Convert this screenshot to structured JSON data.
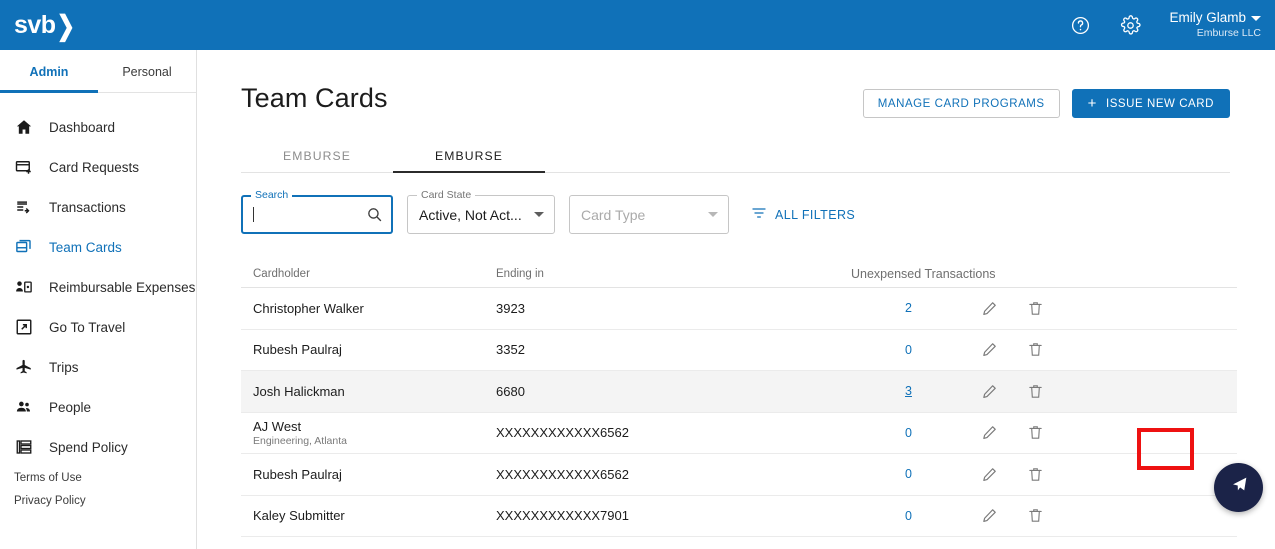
{
  "header": {
    "logo_text": "svb",
    "logo_chevron": "❯",
    "help_icon": "help-circle-icon",
    "settings_icon": "gear-icon",
    "user_name": "Emily Glamb",
    "user_org": "Emburse LLC"
  },
  "sidebar": {
    "tabs": [
      {
        "label": "Admin",
        "active": true
      },
      {
        "label": "Personal",
        "active": false
      }
    ],
    "items": [
      {
        "label": "Dashboard",
        "icon": "home-icon",
        "active": false
      },
      {
        "label": "Card Requests",
        "icon": "card-plus-icon",
        "active": false
      },
      {
        "label": "Transactions",
        "icon": "transactions-icon",
        "active": false
      },
      {
        "label": "Team Cards",
        "icon": "cards-stack-icon",
        "active": true
      },
      {
        "label": "Reimbursable Expenses",
        "icon": "person-card-icon",
        "active": false
      },
      {
        "label": "Go To Travel",
        "icon": "external-link-icon",
        "active": false
      },
      {
        "label": "Trips",
        "icon": "airplane-icon",
        "active": false
      },
      {
        "label": "People",
        "icon": "people-icon",
        "active": false
      },
      {
        "label": "Spend Policy",
        "icon": "policy-list-icon",
        "active": false
      }
    ],
    "footer_links": [
      "Terms of Use",
      "Privacy Policy"
    ]
  },
  "main": {
    "page_title": "Team Cards",
    "manage_programs_label": "MANAGE CARD PROGRAMS",
    "issue_card_label": "ISSUE NEW CARD",
    "issue_card_plus": "+",
    "tabs": [
      {
        "label": "EMBURSE",
        "active": false
      },
      {
        "label": "EMBURSE",
        "active": true
      }
    ],
    "filters": {
      "search_legend": "Search",
      "search_value": "",
      "search_icon": "search-icon",
      "card_state_legend": "Card State",
      "card_state_value": "Active, Not Act...",
      "card_type_placeholder": "Card Type",
      "all_filters_label": "ALL FILTERS",
      "all_filters_icon": "filter-icon"
    },
    "table": {
      "columns": [
        "Cardholder",
        "Ending in",
        "Unexpensed Transactions"
      ],
      "edit_icon": "pencil-icon",
      "delete_icon": "trash-icon",
      "rows": [
        {
          "cardholder": "Christopher Walker",
          "subtitle": "",
          "ending_in": "3923",
          "unexpensed": "2",
          "highlight": false,
          "annotated": false
        },
        {
          "cardholder": "Rubesh Paulraj",
          "subtitle": "",
          "ending_in": "3352",
          "unexpensed": "0",
          "highlight": false,
          "annotated": false
        },
        {
          "cardholder": "Josh Halickman",
          "subtitle": "",
          "ending_in": "6680",
          "unexpensed": "3",
          "highlight": true,
          "annotated": true
        },
        {
          "cardholder": "AJ West",
          "subtitle": "Engineering, Atlanta",
          "ending_in": "XXXXXXXXXXXX6562",
          "unexpensed": "0",
          "highlight": false,
          "annotated": false
        },
        {
          "cardholder": "Rubesh Paulraj",
          "subtitle": "",
          "ending_in": "XXXXXXXXXXXX6562",
          "unexpensed": "0",
          "highlight": false,
          "annotated": false
        },
        {
          "cardholder": "Kaley Submitter",
          "subtitle": "",
          "ending_in": "XXXXXXXXXXXX7901",
          "unexpensed": "0",
          "highlight": false,
          "annotated": false
        }
      ]
    },
    "fab_icon": "send-plane-icon"
  },
  "colors": {
    "brand_blue": "#1071b8",
    "link_blue": "#1071b8",
    "annotation_red": "#ee1111",
    "fab_navy": "#1b2348",
    "row_highlight": "#f4f4f4"
  }
}
